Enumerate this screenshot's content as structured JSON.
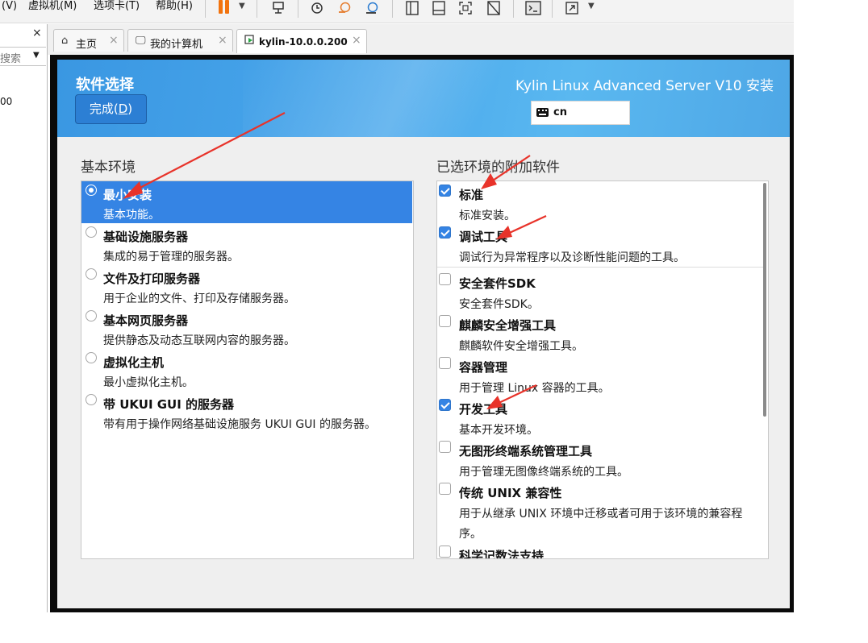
{
  "menu": {
    "items": [
      "(V)",
      "虚拟机(M)",
      "选项卡(T)",
      "帮助(H)"
    ]
  },
  "toolbar": {
    "icons": [
      "pause-icon",
      "send-keys-icon",
      "snapshot-icon",
      "revert-snapshot-icon",
      "snapshot-manager-icon",
      "library-view-icon",
      "thumbnail-view-icon",
      "fullscreen-icon",
      "unity-icon",
      "console-icon",
      "stretch-icon"
    ]
  },
  "library": {
    "close": "×",
    "search_placeholder": "搜索",
    "item": "00"
  },
  "tabs": [
    {
      "label": "主页",
      "icon": "home-icon",
      "close": "×"
    },
    {
      "label": "我的计算机",
      "icon": "computer-icon",
      "close": "×"
    },
    {
      "label": "kylin-10.0.0.200",
      "icon": "vm-running-icon",
      "close": "×",
      "active": true
    }
  ],
  "installer": {
    "spoke_title": "软件选择",
    "done_label": "完成(",
    "done_mnemonic": "D",
    "done_suffix": ")",
    "product_title": "Kylin Linux Advanced Server V10 安装",
    "keyboard_layout": "cn",
    "base_env_title": "基本环境",
    "addons_title": "已选环境的附加软件",
    "environments": [
      {
        "name": "最小安装",
        "desc": "基本功能。",
        "selected": true
      },
      {
        "name": "基础设施服务器",
        "desc": "集成的易于管理的服务器。",
        "selected": false
      },
      {
        "name": "文件及打印服务器",
        "desc": "用于企业的文件、打印及存储服务器。",
        "selected": false
      },
      {
        "name": "基本网页服务器",
        "desc": "提供静态及动态互联网内容的服务器。",
        "selected": false
      },
      {
        "name": "虚拟化主机",
        "desc": "最小虚拟化主机。",
        "selected": false
      },
      {
        "name": "带 UKUI GUI 的服务器",
        "desc": "带有用于操作网络基础设施服务 UKUI GUI 的服务器。",
        "selected": false
      }
    ],
    "addons": [
      {
        "name": "标准",
        "desc": "标准安装。",
        "checked": true
      },
      {
        "name": "调试工具",
        "desc": "调试行为异常程序以及诊断性能问题的工具。",
        "checked": true
      },
      {
        "name": "安全套件SDK",
        "desc": "安全套件SDK。",
        "checked": false
      },
      {
        "name": "麒麟安全增强工具",
        "desc": "麒麟软件安全增强工具。",
        "checked": false
      },
      {
        "name": "容器管理",
        "desc": "用于管理 Linux 容器的工具。",
        "checked": false
      },
      {
        "name": "开发工具",
        "desc": "基本开发环境。",
        "checked": true
      },
      {
        "name": "无图形终端系统管理工具",
        "desc": "用于管理无图像终端系统的工具。",
        "checked": false
      },
      {
        "name": "传统 UNIX 兼容性",
        "desc": "用于从继承 UNIX 环境中迁移或者可用于该环境的兼容程序。",
        "checked": false
      },
      {
        "name": "科学记数法支持",
        "desc": "",
        "checked": false
      }
    ]
  },
  "colors": {
    "header_blue": "#3a97e2",
    "selection_blue": "#3584e4",
    "annotation_red": "#e8332a",
    "pause_orange": "#f2730e"
  }
}
